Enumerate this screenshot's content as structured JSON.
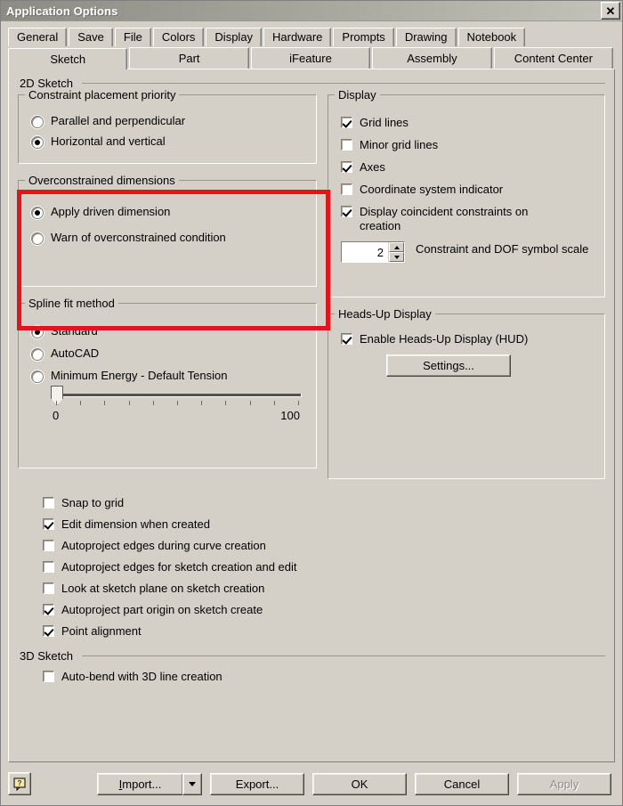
{
  "window": {
    "title": "Application Options",
    "close_label": "✕"
  },
  "tabs": {
    "row1": [
      {
        "label": "General",
        "active": false
      },
      {
        "label": "Save",
        "active": false
      },
      {
        "label": "File",
        "active": false
      },
      {
        "label": "Colors",
        "active": false
      },
      {
        "label": "Display",
        "active": false
      },
      {
        "label": "Hardware",
        "active": false
      },
      {
        "label": "Prompts",
        "active": false
      },
      {
        "label": "Drawing",
        "active": false
      },
      {
        "label": "Notebook",
        "active": false
      }
    ],
    "row2": [
      {
        "label": "Sketch",
        "active": true
      },
      {
        "label": "Part",
        "active": false
      },
      {
        "label": "iFeature",
        "active": false
      },
      {
        "label": "Assembly",
        "active": false
      },
      {
        "label": "Content Center",
        "active": false
      }
    ]
  },
  "sections": {
    "sketch2d_header": "2D Sketch",
    "sketch3d_header": "3D Sketch"
  },
  "constraint_priority": {
    "legend": "Constraint placement priority",
    "options": [
      {
        "label": "Parallel and perpendicular",
        "selected": false
      },
      {
        "label": "Horizontal and vertical",
        "selected": true
      }
    ]
  },
  "overconstrained": {
    "legend": "Overconstrained dimensions",
    "options": [
      {
        "label": "Apply driven dimension",
        "selected": true
      },
      {
        "label": "Warn of overconstrained condition",
        "selected": false
      }
    ],
    "highlighted": true,
    "highlight_color": "#e8131a"
  },
  "spline_fit": {
    "legend": "Spline fit method",
    "options": [
      {
        "label": "Standard",
        "selected": true
      },
      {
        "label": "AutoCAD",
        "selected": false
      },
      {
        "label": "Minimum Energy - Default Tension",
        "selected": false
      }
    ],
    "slider": {
      "min_label": "0",
      "max_label": "100",
      "value": 0,
      "min": 0,
      "max": 100,
      "tick_count": 11
    }
  },
  "display": {
    "legend": "Display",
    "checkboxes": [
      {
        "label": "Grid lines",
        "checked": true
      },
      {
        "label": "Minor grid lines",
        "checked": false
      },
      {
        "label": "Axes",
        "checked": true
      },
      {
        "label": "Coordinate system indicator",
        "checked": false
      },
      {
        "label": "Display coincident constraints on creation",
        "checked": true
      }
    ],
    "symbol_scale": {
      "value": "2",
      "label": "Constraint and DOF symbol scale"
    }
  },
  "hud": {
    "legend": "Heads-Up Display",
    "enable_label": "Enable Heads-Up Display (HUD)",
    "enable_checked": true,
    "settings_button": "Settings..."
  },
  "sketch_options": [
    {
      "label": "Snap to grid",
      "checked": false
    },
    {
      "label": "Edit dimension when created",
      "checked": true
    },
    {
      "label": "Autoproject edges during curve creation",
      "checked": false
    },
    {
      "label": "Autoproject edges for sketch creation and edit",
      "checked": false
    },
    {
      "label": "Look at sketch plane on sketch creation",
      "checked": false
    },
    {
      "label": "Autoproject part origin on sketch create",
      "checked": true
    },
    {
      "label": "Point alignment",
      "checked": true
    }
  ],
  "sketch3d_options": [
    {
      "label": "Auto-bend with 3D line creation",
      "checked": false
    }
  ],
  "footer": {
    "help_icon": "help-icon",
    "help_glyph": "?",
    "import_label": "Import...",
    "import_accel": "I",
    "export_label": "Export...",
    "ok_label": "OK",
    "cancel_label": "Cancel",
    "apply_label": "Apply",
    "apply_disabled": true
  }
}
